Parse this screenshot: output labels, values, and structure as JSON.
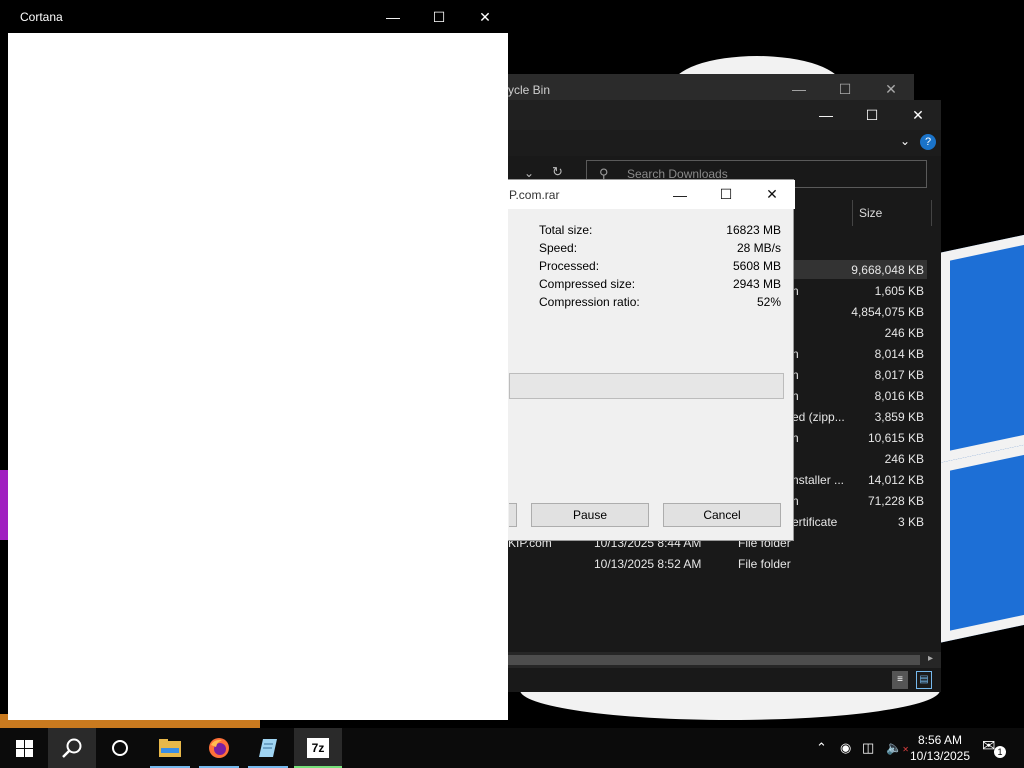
{
  "cortana": {
    "title": "Cortana"
  },
  "recycle_bin": {
    "title": "ycle Bin"
  },
  "explorer": {
    "search_placeholder": "Search Downloads",
    "column_size": "Size",
    "rows": [
      {
        "type": "",
        "size": "9,668,048 KB",
        "highlighted": true
      },
      {
        "type": "n",
        "size": "1,605 KB"
      },
      {
        "type": "",
        "size": "4,854,075 KB"
      },
      {
        "type": "",
        "size": "246 KB"
      },
      {
        "type": "n",
        "size": "8,014 KB"
      },
      {
        "type": "n",
        "size": "8,017 KB"
      },
      {
        "type": "n",
        "size": "8,016 KB"
      },
      {
        "type": "ed (zipp...",
        "size": "3,859 KB"
      },
      {
        "type": "n",
        "size": "10,615 KB"
      },
      {
        "type": "",
        "size": "246 KB"
      },
      {
        "type": "nstaller ...",
        "size": "14,012 KB"
      },
      {
        "type": "n",
        "size": "71,228 KB"
      },
      {
        "type": "ertificate",
        "size": "3 KB"
      }
    ],
    "folders": [
      {
        "name": "KIP.com",
        "date": "10/13/2025 8:44 AM",
        "type": "File folder"
      },
      {
        "name": "",
        "date": "10/13/2025 8:52 AM",
        "type": "File folder"
      }
    ]
  },
  "sevenzip": {
    "title": "P.com.rar",
    "stats": [
      {
        "label": "Total size:",
        "value": "16823 MB"
      },
      {
        "label": "Speed:",
        "value": "28 MB/s"
      },
      {
        "label": "Processed:",
        "value": "5608 MB"
      },
      {
        "label": "Compressed size:",
        "value": "2943 MB"
      },
      {
        "label": "Compression ratio:",
        "value": "52%"
      }
    ],
    "pause_label": "Pause",
    "cancel_label": "Cancel"
  },
  "taskbar": {
    "time": "8:56 AM",
    "date": "10/13/2025",
    "notification_count": "1",
    "apps": [
      "windows-start-icon",
      "search-icon",
      "cortana-icon",
      "file-explorer-icon",
      "firefox-icon",
      "notepad-icon",
      "7zip-icon"
    ],
    "sevenzip_label": "7z"
  },
  "colors": {
    "accent": "#76b9ed",
    "wallpaper_blue": "#1d6fd6"
  }
}
